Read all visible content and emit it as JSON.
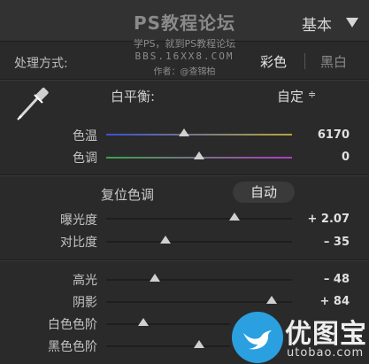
{
  "header": {
    "watermark_title": "PS教程论坛",
    "panel_title": "基本"
  },
  "watermark": {
    "line1": "学PS，就到PS教程论坛",
    "line2": "BBS.16XX8.COM",
    "line3": "作者：@查锦柏"
  },
  "treatment": {
    "label": "处理方式:",
    "color": "彩色",
    "bw": "黑白"
  },
  "white_balance": {
    "label": "白平衡:",
    "value": "自定",
    "arrow": "≑"
  },
  "wb_sliders": [
    {
      "label": "色温",
      "value": "6170",
      "position": 0.42
    },
    {
      "label": "色调",
      "value": "0",
      "position": 0.5
    }
  ],
  "tone": {
    "label": "复位色调",
    "auto": "自动"
  },
  "tone_sliders": [
    {
      "label": "曝光度",
      "value": "+ 2.07",
      "position": 0.69
    },
    {
      "label": "对比度",
      "value": "– 35",
      "position": 0.32
    }
  ],
  "range_sliders": [
    {
      "label": "高光",
      "value": "– 48",
      "position": 0.26
    },
    {
      "label": "阴影",
      "value": "+ 84",
      "position": 0.89
    },
    {
      "label": "白色色阶",
      "value": "",
      "position": 0.2
    },
    {
      "label": "黑色色阶",
      "value": "",
      "position": 0.5
    }
  ],
  "logo": {
    "cn": "优图宝",
    "url": "utobao.com"
  },
  "colors": {
    "accent_blue": "#2aa0e0",
    "temp_start": "#3a4fd6",
    "temp_end": "#b8a43a",
    "tint_start": "#3ca34a",
    "tint_end": "#b03cc2"
  }
}
